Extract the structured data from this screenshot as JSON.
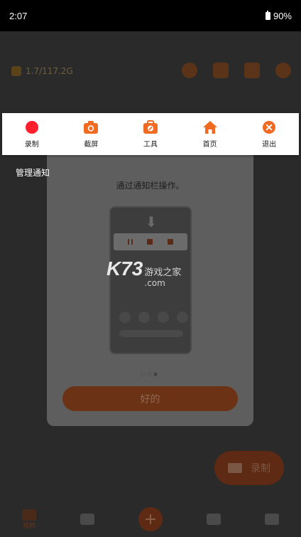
{
  "status": {
    "time": "2:07",
    "battery": "90%"
  },
  "app": {
    "storage_text": "1.7/117.2G",
    "record_fab_label": "录制",
    "nav": {
      "video_label": "视频"
    }
  },
  "dialog": {
    "caption": "通过通知栏操作。",
    "ok_label": "好的",
    "pager": "○○●"
  },
  "watermark": {
    "logo": "K73",
    "cn": "游戏之家",
    "com": ".com"
  },
  "toolbar": {
    "items": [
      {
        "label": "录制",
        "icon": "record-icon"
      },
      {
        "label": "截屏",
        "icon": "camera-icon"
      },
      {
        "label": "工具",
        "icon": "toolbox-icon"
      },
      {
        "label": "首页",
        "icon": "home-icon"
      },
      {
        "label": "退出",
        "icon": "close-icon"
      }
    ],
    "colors": {
      "record": "#ff1f2d",
      "accent": "#f06a22"
    }
  },
  "manage_notification": "管理通知"
}
